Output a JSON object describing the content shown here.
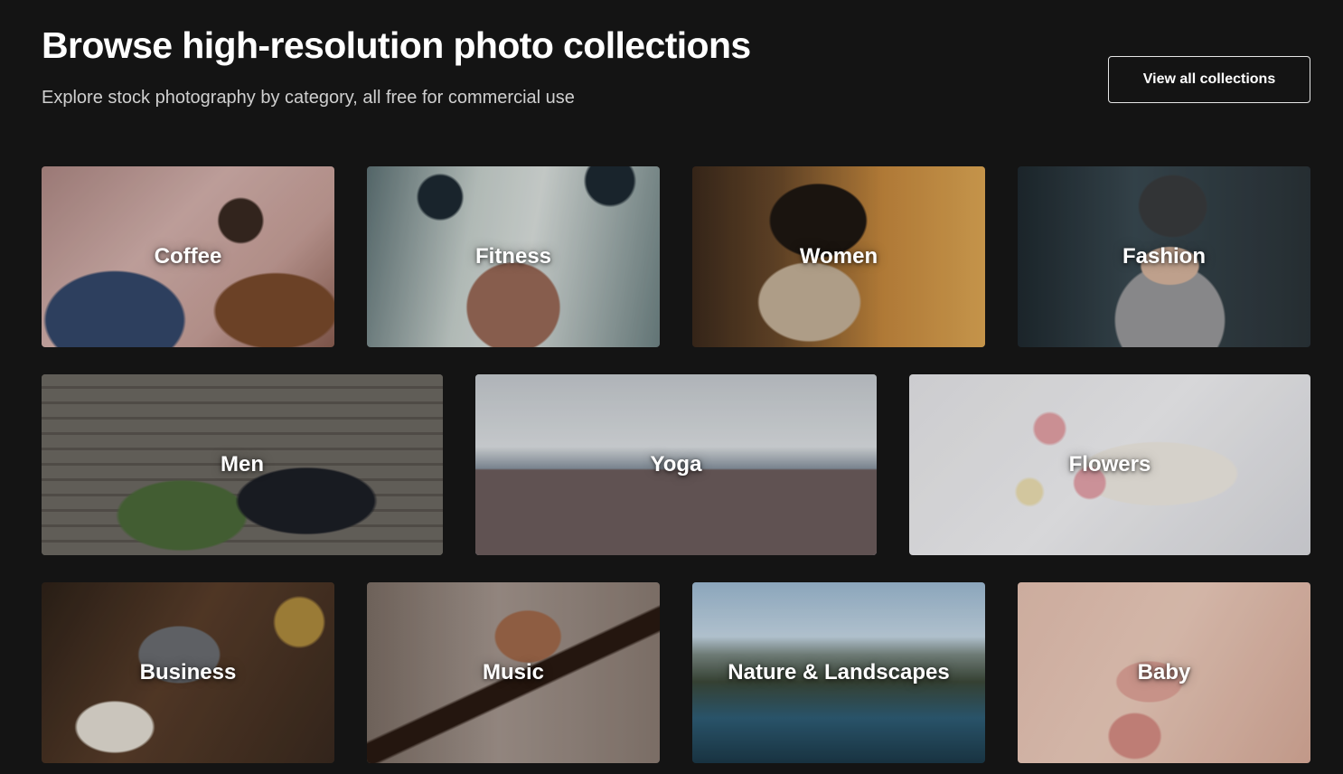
{
  "header": {
    "title": "Browse high-resolution photo collections",
    "subtitle": "Explore stock photography by category, all free for commercial use",
    "view_all_label": "View all collections"
  },
  "collections": [
    {
      "label": "Coffee"
    },
    {
      "label": "Fitness"
    },
    {
      "label": "Women"
    },
    {
      "label": "Fashion"
    },
    {
      "label": "Men"
    },
    {
      "label": "Yoga"
    },
    {
      "label": "Flowers"
    },
    {
      "label": "Business"
    },
    {
      "label": "Music"
    },
    {
      "label": "Nature & Landscapes"
    },
    {
      "label": "Baby"
    }
  ],
  "colors": {
    "background": "#141414",
    "text": "#ffffff",
    "subtitle": "#cfcfcf",
    "button_border": "#e6e6e6"
  }
}
